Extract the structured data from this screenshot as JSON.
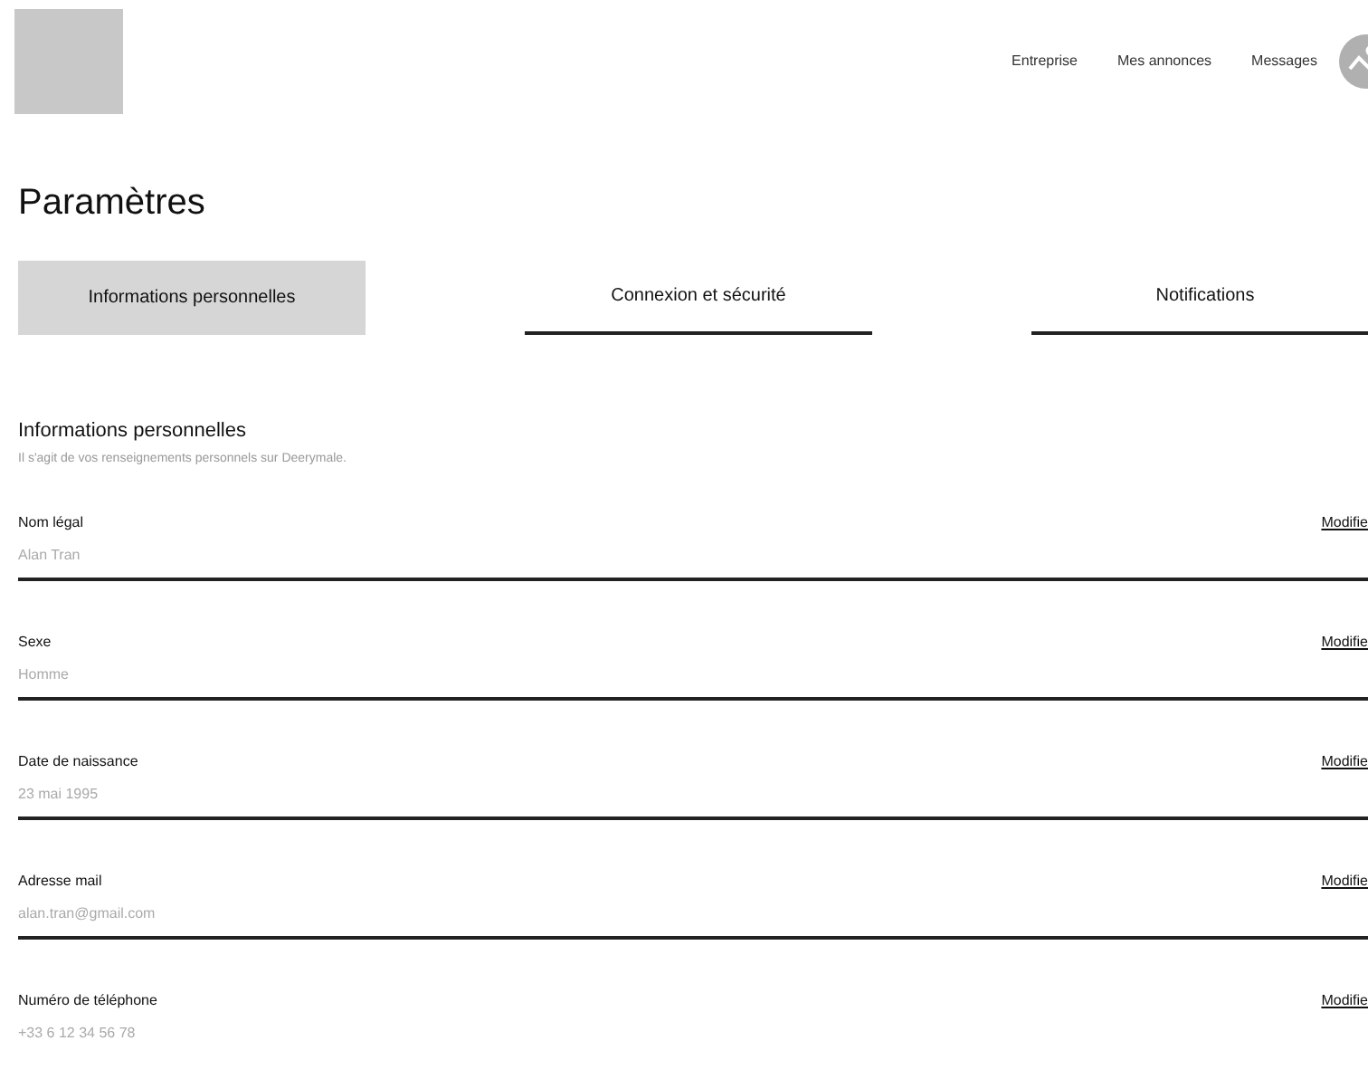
{
  "nav": {
    "links": [
      "Entreprise",
      "Mes annonces",
      "Messages"
    ]
  },
  "title": "Paramètres",
  "tabs": [
    {
      "label": "Informations personnelles",
      "selected": true
    },
    {
      "label": "Connexion et sécurité",
      "selected": false
    },
    {
      "label": "Notifications",
      "selected": false
    }
  ],
  "section": {
    "heading": "Informations personnelles",
    "description": "Il s'agit de vos renseignements personnels sur Deerymale."
  },
  "fields": [
    {
      "label": "Nom légal",
      "value": "Alan Tran",
      "action": "Modifie"
    },
    {
      "label": "Sexe",
      "value": "Homme",
      "action": "Modifie"
    },
    {
      "label": "Date de naissance",
      "value": "23 mai 1995",
      "action": "Modifie"
    },
    {
      "label": "Adresse mail",
      "value": "alan.tran@gmail.com",
      "action": "Modifie"
    },
    {
      "label": "Numéro de téléphone",
      "value": "+33 6 12 34 56 78",
      "action": "Modifie"
    }
  ]
}
